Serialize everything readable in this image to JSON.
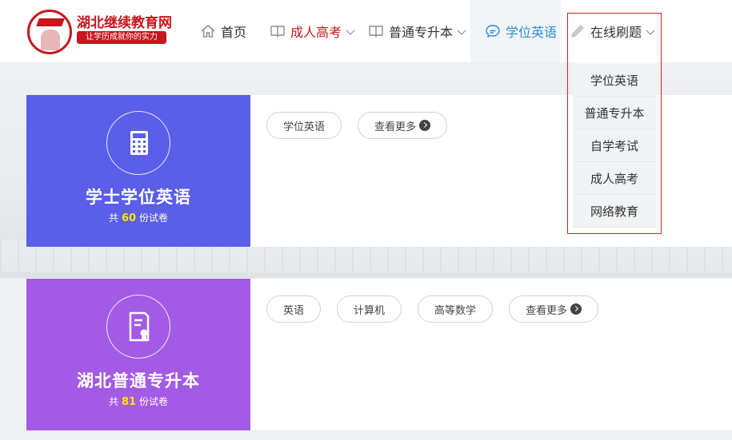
{
  "logo": {
    "title": "湖北继续教育网",
    "slogan": "让学历成就你的实力"
  },
  "nav": {
    "home": "首页",
    "adult_exam": "成人高考",
    "upgrade": "普通专升本",
    "degree_english": "学位英语",
    "online_practice": "在线刷题"
  },
  "dropdown": {
    "items": [
      "学位英语",
      "普通专升本",
      "自学考试",
      "成人高考",
      "网络教育"
    ]
  },
  "cards": [
    {
      "title": "学士学位英语",
      "count_prefix": "共",
      "count": "60",
      "count_suffix": "份试卷",
      "tags": [
        "学位英语"
      ],
      "more": "查看更多"
    },
    {
      "title": "湖北普通专升本",
      "count_prefix": "共",
      "count": "81",
      "count_suffix": "份试卷",
      "tags": [
        "英语",
        "计算机",
        "高等数学"
      ],
      "more": "查看更多"
    }
  ],
  "colors": {
    "brand_red": "#c8161d",
    "card1_bg": "#5a5ee8",
    "card2_bg": "#a35be6",
    "active_blue": "#2a8fd8",
    "highlight_border": "#e02020"
  }
}
